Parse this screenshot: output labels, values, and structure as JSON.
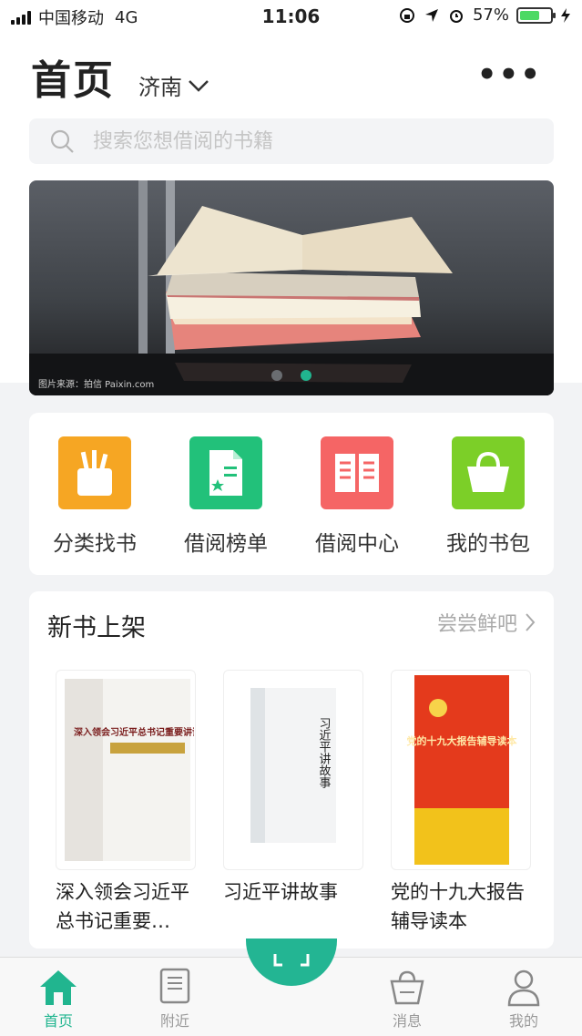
{
  "status_bar": {
    "carrier": "中国移动",
    "network": "4G",
    "time": "11:06",
    "battery": "57%"
  },
  "header": {
    "title": "首页",
    "city": "济南",
    "more_label": "•••"
  },
  "search": {
    "placeholder": "搜索您想借阅的书籍"
  },
  "banner": {
    "credit": "图片来源：拍信 Paixin.com",
    "slides_total": 2,
    "active_slide": 2
  },
  "categories": [
    {
      "label": "分类找书",
      "icon": "pencil-cup-icon",
      "color": "#f6a623"
    },
    {
      "label": "借阅榜单",
      "icon": "document-star-icon",
      "color": "#22c17a"
    },
    {
      "label": "借阅中心",
      "icon": "open-book-icon",
      "color": "#f56565"
    },
    {
      "label": "我的书包",
      "icon": "shopping-bag-icon",
      "color": "#7ccf28"
    }
  ],
  "new_books": {
    "title": "新书上架",
    "more": "尝尝鲜吧",
    "items": [
      {
        "name": "深入领会习近平总书记重要…",
        "cover_text": "深入领会习近平总书记重要讲话精神"
      },
      {
        "name": "习近平讲故事",
        "cover_text": "习近平讲故事"
      },
      {
        "name": "党的十九大报告辅导读本",
        "cover_text": "党的十九大报告辅导读本"
      }
    ]
  },
  "tabs": [
    {
      "label": "首页",
      "icon": "home-icon",
      "active": true
    },
    {
      "label": "附近",
      "icon": "book-icon",
      "active": false
    },
    {
      "label": "消息",
      "icon": "basket-icon",
      "active": false
    },
    {
      "label": "我的",
      "icon": "user-icon",
      "active": false
    }
  ],
  "colors": {
    "accent": "#21b58f",
    "bg": "#f2f3f5"
  }
}
